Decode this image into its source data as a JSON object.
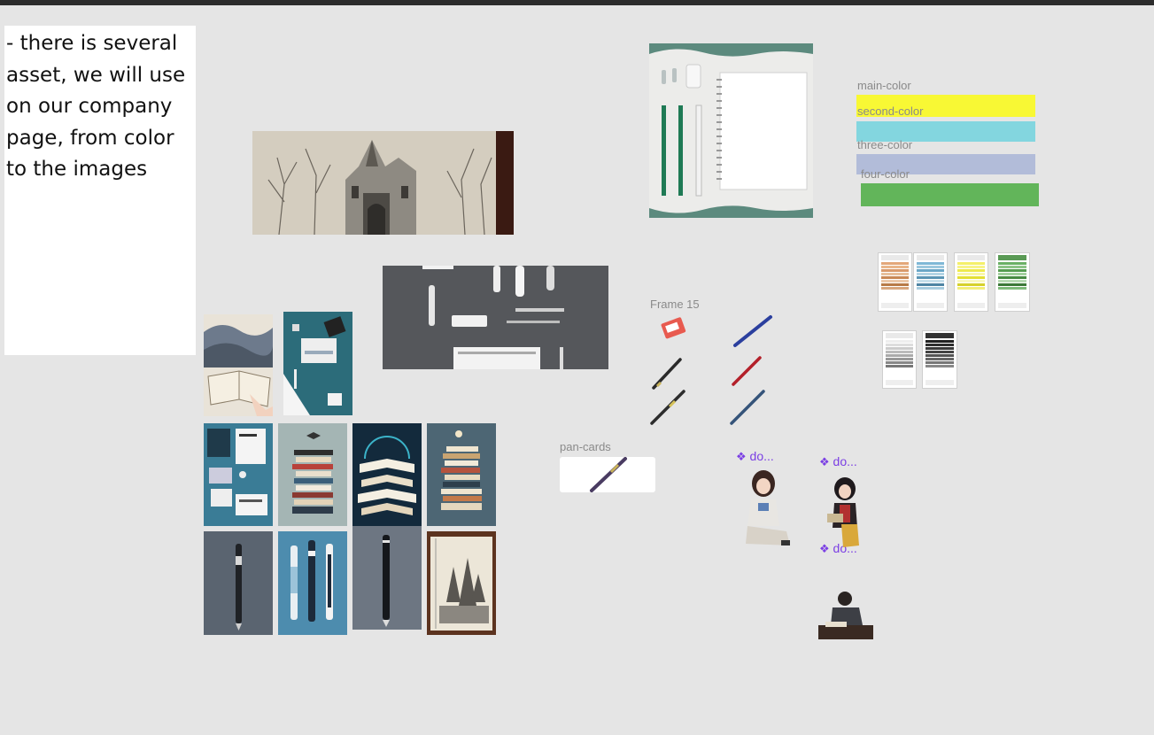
{
  "canvas": {
    "background": "#e5e5e5",
    "topbar_color": "#2c2c2c"
  },
  "note": {
    "text": "- there is several\nasset, we will use\non our company\npage, from color\nto the images"
  },
  "frames": {
    "frame15": "Frame 15",
    "pan_cards": "pan-cards"
  },
  "components": [
    {
      "glyph": "❖",
      "label": "do..."
    },
    {
      "glyph": "❖",
      "label": "do..."
    },
    {
      "glyph": "❖",
      "label": "do..."
    }
  ],
  "colors": [
    {
      "label": "main-color",
      "hex": "#f8f834"
    },
    {
      "label": "second-color",
      "hex": "#83d6df"
    },
    {
      "label": "three-color",
      "hex": "#b2bcd9"
    },
    {
      "label": "four-color",
      "hex": "#62b55a"
    }
  ],
  "icons": {
    "sketch_castle": "castle-sketch-image",
    "stationery_top": "stationery-flatlay-image",
    "notebook": "notebook-pencils-image",
    "reading": "open-book-reading-image",
    "desk": "teal-desk-flatlay-image",
    "pen_grid": "pen-illustration-image",
    "component": "component-diamond-icon"
  }
}
